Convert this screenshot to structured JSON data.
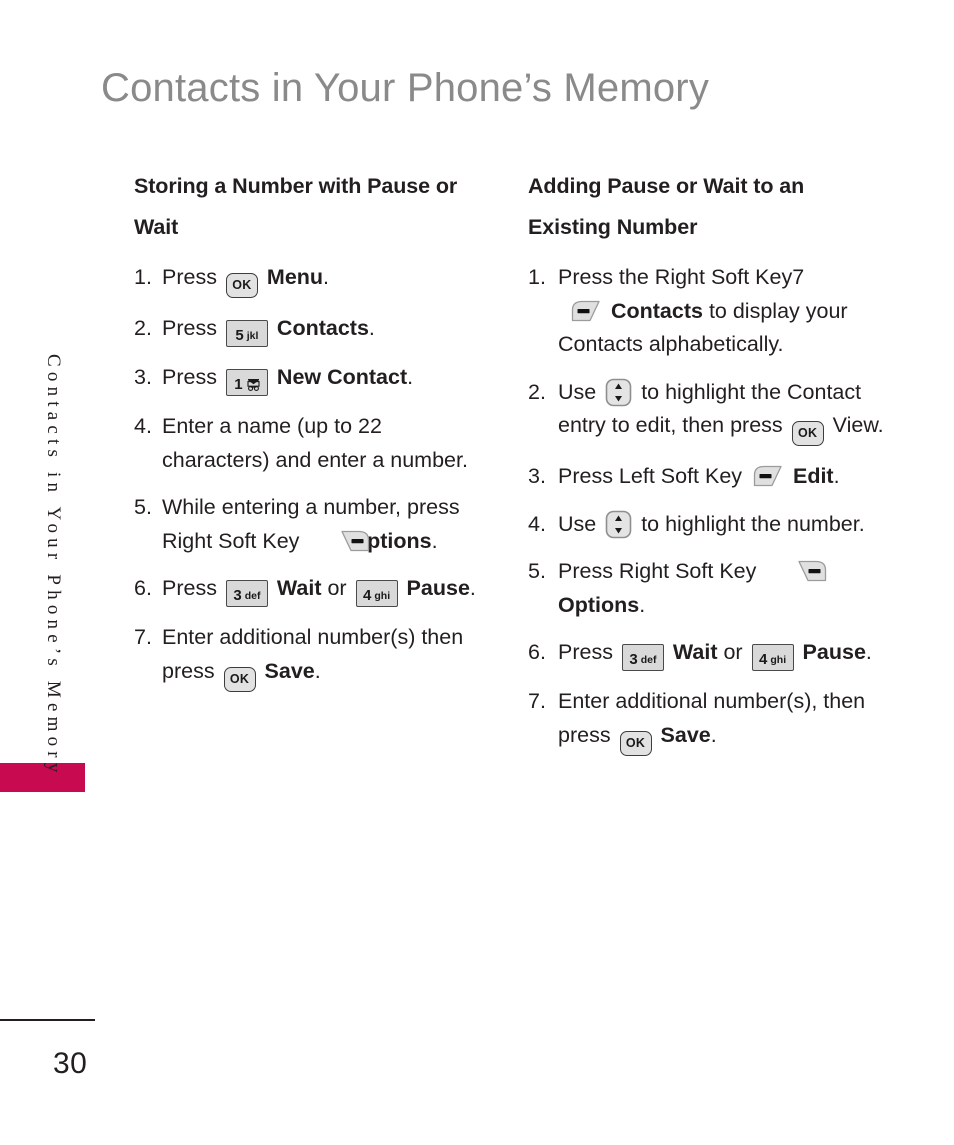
{
  "page": {
    "title": "Contacts in Your Phone’s Memory",
    "side_tab_label": "Contacts in Your Phone’s Memory",
    "page_number": "30",
    "accent_color": "#c80a50",
    "title_color": "#8a8a8a",
    "text_color": "#231f20"
  },
  "left_column": {
    "heading": "Storing a Number with Pause or Wait",
    "steps": [
      {
        "num": "1.",
        "parts": [
          {
            "type": "text",
            "value": "Press "
          },
          {
            "type": "key-ok",
            "label": "OK"
          },
          {
            "type": "bold",
            "value": " Menu"
          },
          {
            "type": "text",
            "value": "."
          }
        ]
      },
      {
        "num": "2.",
        "parts": [
          {
            "type": "text",
            "value": "Press "
          },
          {
            "type": "key-pad",
            "digit": "5",
            "letters": "jkl"
          },
          {
            "type": "bold",
            "value": " Contacts"
          },
          {
            "type": "text",
            "value": "."
          }
        ]
      },
      {
        "num": "3.",
        "parts": [
          {
            "type": "text",
            "value": "Press "
          },
          {
            "type": "key-pad",
            "digit": "1",
            "letters": "",
            "icon": "voicemail-icon"
          },
          {
            "type": "bold",
            "value": " New Contact"
          },
          {
            "type": "text",
            "value": "."
          }
        ]
      },
      {
        "num": "4.",
        "parts": [
          {
            "type": "text",
            "value": "Enter a name (up to 22 characters) and enter a number."
          }
        ]
      },
      {
        "num": "5.",
        "parts": [
          {
            "type": "text",
            "value": "While entering a number, press Right Soft Key "
          },
          {
            "type": "key-soft",
            "side": "right"
          },
          {
            "type": "bold",
            "value": " Options"
          },
          {
            "type": "text",
            "value": "."
          }
        ]
      },
      {
        "num": "6.",
        "parts": [
          {
            "type": "text",
            "value": "Press "
          },
          {
            "type": "key-pad",
            "digit": "3",
            "letters": "def"
          },
          {
            "type": "bold",
            "value": " Wait"
          },
          {
            "type": "text",
            "value": " or "
          },
          {
            "type": "key-pad",
            "digit": "4",
            "letters": "ghi"
          },
          {
            "type": "bold",
            "value": " Pause"
          },
          {
            "type": "text",
            "value": "."
          }
        ]
      },
      {
        "num": "7.",
        "parts": [
          {
            "type": "text",
            "value": "Enter additional number(s) then press "
          },
          {
            "type": "key-ok",
            "label": "OK"
          },
          {
            "type": "bold",
            "value": " Save"
          },
          {
            "type": "text",
            "value": "."
          }
        ]
      }
    ]
  },
  "right_column": {
    "heading": "Adding Pause or Wait to an Existing Number",
    "steps": [
      {
        "num": "1.",
        "parts": [
          {
            "type": "text",
            "value": "Press the Right Soft Key7"
          },
          {
            "type": "break"
          },
          {
            "type": "indent"
          },
          {
            "type": "key-soft",
            "side": "left"
          },
          {
            "type": "bold",
            "value": " Contacts"
          },
          {
            "type": "text",
            "value": " to display your Contacts alphabetically."
          }
        ]
      },
      {
        "num": "2.",
        "parts": [
          {
            "type": "text",
            "value": "Use "
          },
          {
            "type": "key-nav"
          },
          {
            "type": "text",
            "value": " to highlight the Contact entry to edit, then press "
          },
          {
            "type": "key-ok",
            "label": "OK"
          },
          {
            "type": "text",
            "value": " View."
          }
        ]
      },
      {
        "num": "3.",
        "parts": [
          {
            "type": "text",
            "value": "Press Left Soft Key "
          },
          {
            "type": "key-soft",
            "side": "left"
          },
          {
            "type": "bold",
            "value": " Edit"
          },
          {
            "type": "text",
            "value": "."
          }
        ]
      },
      {
        "num": "4.",
        "parts": [
          {
            "type": "text",
            "value": "Use "
          },
          {
            "type": "key-nav"
          },
          {
            "type": "text",
            "value": " to highlight the number."
          }
        ]
      },
      {
        "num": "5.",
        "parts": [
          {
            "type": "text",
            "value": "Press Right Soft Key "
          },
          {
            "type": "key-soft",
            "side": "right"
          },
          {
            "type": "bold",
            "value": " Options"
          },
          {
            "type": "text",
            "value": "."
          }
        ]
      },
      {
        "num": "6.",
        "parts": [
          {
            "type": "text",
            "value": "Press "
          },
          {
            "type": "key-pad",
            "digit": "3",
            "letters": "def"
          },
          {
            "type": "bold",
            "value": " Wait"
          },
          {
            "type": "text",
            "value": " or "
          },
          {
            "type": "key-pad",
            "digit": "4",
            "letters": "ghi"
          },
          {
            "type": "bold",
            "value": " Pause"
          },
          {
            "type": "text",
            "value": "."
          }
        ]
      },
      {
        "num": "7.",
        "parts": [
          {
            "type": "text",
            "value": "Enter additional number(s), then press "
          },
          {
            "type": "key-ok",
            "label": "OK"
          },
          {
            "type": "bold",
            "value": " Save"
          },
          {
            "type": "text",
            "value": "."
          }
        ]
      }
    ]
  }
}
